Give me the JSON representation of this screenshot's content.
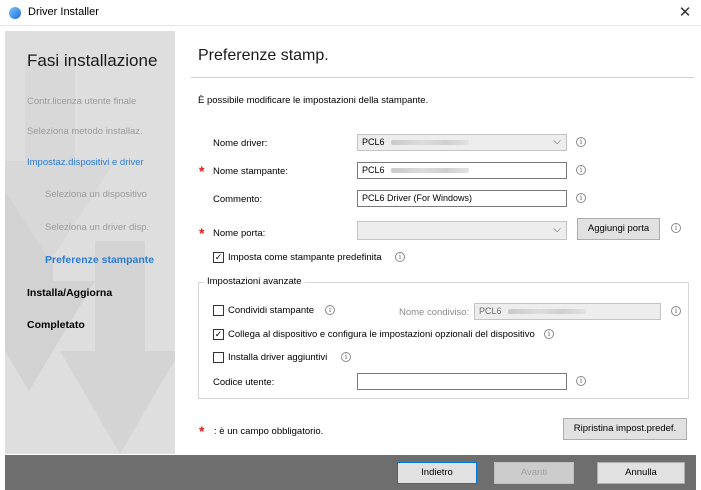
{
  "window": {
    "title": "Driver Installer"
  },
  "sidebar": {
    "heading": "Fasi installazione",
    "steps": [
      {
        "label": "Contr.licenza utente finale"
      },
      {
        "label": "Seleziona metodo installaz."
      },
      {
        "label": "Impostaz.dispositivi e driver"
      },
      {
        "label": "Seleziona un dispositivo"
      },
      {
        "label": "Seleziona un driver disp."
      },
      {
        "label": "Preferenze stampante"
      },
      {
        "label": "Installa/Aggiorna"
      },
      {
        "label": "Completato"
      }
    ]
  },
  "main": {
    "title": "Preferenze stamp.",
    "intro": "È possibile modificare le impostazioni della stampante.",
    "form": {
      "driver_name_label": "Nome driver:",
      "driver_name_value": "PCL6",
      "printer_name_label": "Nome stampante:",
      "printer_name_value": "PCL6",
      "comment_label": "Commento:",
      "comment_value": "PCL6 Driver (For Windows)",
      "port_label": "Nome porta:",
      "port_value": "",
      "add_port_label": "Aggiungi porta",
      "default_printer_label": "Imposta come stampante predefinita",
      "default_printer_checked": true
    },
    "advanced": {
      "title": "Impostazioni avanzate",
      "share_label": "Condividi stampante",
      "share_checked": false,
      "share_name_label": "Nome condiviso:",
      "share_name_value": "PCL6",
      "connect_label": "Collega al dispositivo e configura le impostazioni opzionali del dispositivo",
      "connect_checked": true,
      "extra_drivers_label": "Installa driver aggiuntivi",
      "extra_drivers_checked": false,
      "user_code_label": "Codice utente:",
      "user_code_value": ""
    },
    "required_note": ": è un campo obbligatorio.",
    "required_mark": "*",
    "reset_label": "Ripristina impost.predef."
  },
  "footer": {
    "back_label": "Indietro",
    "next_label": "Avanti",
    "cancel_label": "Annulla"
  },
  "icons": {
    "app": "driver-installer-icon",
    "close": "close-icon",
    "info": "info-icon",
    "dropdown": "chevron-down-icon",
    "check": "checkmark-icon"
  },
  "colors": {
    "accent": "#2b7cd6",
    "required": "#e01b1b",
    "sidebar_bg": "#dedede",
    "footer_bg": "#6e6e6e"
  }
}
